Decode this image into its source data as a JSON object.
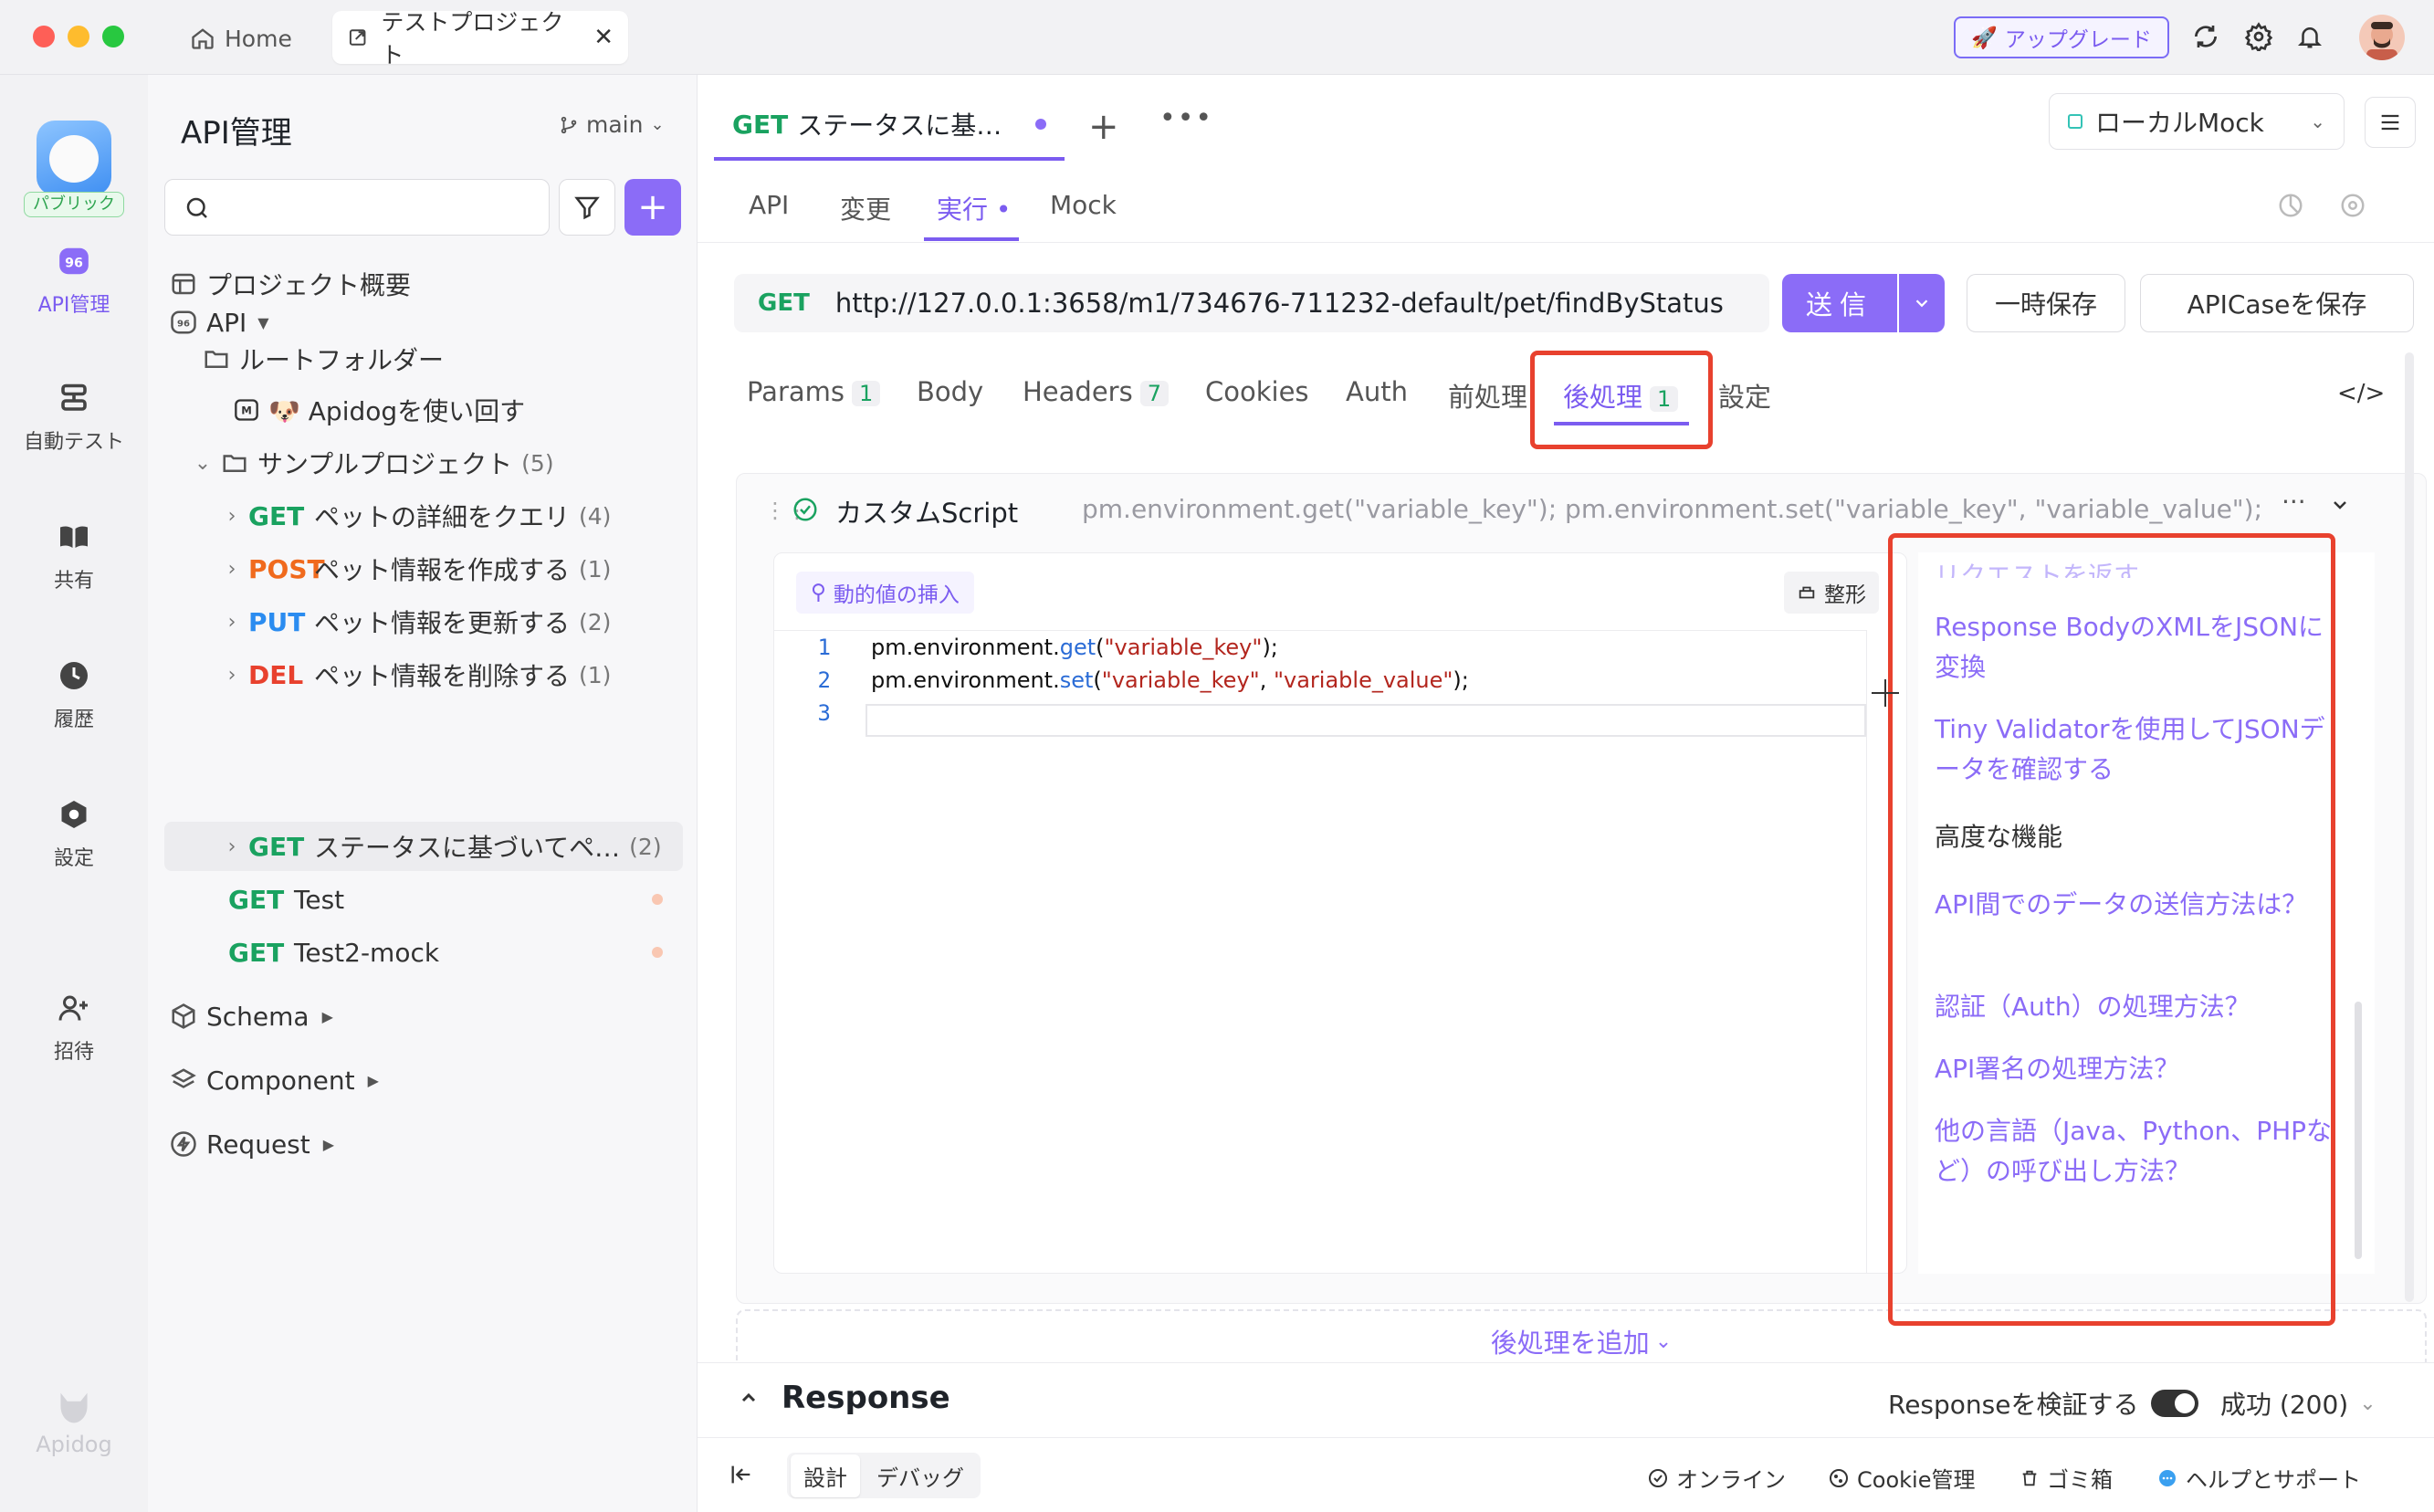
{
  "titlebar": {
    "home_label": "Home",
    "project_tab": "テストプロジェクト",
    "upgrade_label": "アップグレード"
  },
  "rail": {
    "public_badge": "パブリック",
    "items": [
      {
        "label": "API管理",
        "icon": "api-icon",
        "active": true
      },
      {
        "label": "自動テスト",
        "icon": "autotest-icon"
      },
      {
        "label": "共有",
        "icon": "book-icon"
      },
      {
        "label": "履歴",
        "icon": "clock-icon"
      },
      {
        "label": "設定",
        "icon": "hexagon-settings-icon"
      },
      {
        "label": "招待",
        "icon": "invite-icon"
      }
    ],
    "brand": "Apidog"
  },
  "sidebar": {
    "title": "API管理",
    "branch": "main",
    "search_placeholder": "",
    "overview": "プロジェクト概要",
    "api_root": "API",
    "root_folder": "ルートフォルダー",
    "apidog_doc": "🐶 Apidogを使い回す",
    "sample_project": "サンプルプロジェクト",
    "sample_count": "(5)",
    "endpoints": [
      {
        "method": "GET",
        "name": "ペットの詳細をクエリ",
        "count": "(4)"
      },
      {
        "method": "POST",
        "name": "ペット情報を作成する",
        "count": "(1)"
      },
      {
        "method": "PUT",
        "name": "ペット情報を更新する",
        "count": "(2)"
      },
      {
        "method": "DEL",
        "name": "ペット情報を削除する",
        "count": "(1)"
      },
      {
        "method": "GET",
        "name": "ステータスに基づいてペ…",
        "count": "(2)"
      }
    ],
    "extra": [
      {
        "method": "GET",
        "name": "Test"
      },
      {
        "method": "GET",
        "name": "Test2-mock"
      }
    ],
    "schema": "Schema",
    "component": "Component",
    "request": "Request"
  },
  "main": {
    "req_tab_method": "GET",
    "req_tab_name": "ステータスに基…",
    "env": "ローカルMock",
    "subtabs": [
      "API",
      "変更",
      "実行",
      "Mock"
    ],
    "url_method": "GET",
    "url": "http://127.0.0.1:3658/m1/734676-711232-default/pet/findByStatus",
    "send": "送信",
    "save_tmp": "一時保存",
    "save_case": "APICaseを保存",
    "ptabs": [
      {
        "label": "Params",
        "badge": "1"
      },
      {
        "label": "Body",
        "badge": ""
      },
      {
        "label": "Headers",
        "badge": "7"
      },
      {
        "label": "Cookies",
        "badge": ""
      },
      {
        "label": "Auth",
        "badge": ""
      },
      {
        "label": "前処理",
        "badge": ""
      },
      {
        "label": "後処理",
        "badge": "1"
      },
      {
        "label": "設定",
        "badge": ""
      }
    ],
    "script": {
      "name": "カスタムScript",
      "preview": "pm.environment.get(\"variable_key\"); pm.environment.set(\"variable_key\", \"variable_value\");",
      "dynamic_btn": "動的値の挿入",
      "format_btn": "整形",
      "lines": [
        "1",
        "2",
        "3"
      ]
    },
    "snippets": {
      "partial_top": "リクエストを返す",
      "items": [
        "Response BodyのXMLをJSONに変換",
        "Tiny Validatorを使用してJSONデータを確認する"
      ],
      "advanced_head": "高度な機能",
      "advanced": [
        "API間でのデータの送信方法は？",
        "認証（Auth）の処理方法？",
        "API署名の処理方法？",
        "他の言語（Java、Python、PHPなど）の呼び出し方法？"
      ]
    },
    "add_post": "後処理を追加",
    "response": {
      "title": "Response",
      "verify": "Responseを検証する",
      "status": "成功 (200)"
    },
    "statusbar": {
      "design": "設計",
      "debug": "デバッグ",
      "online": "オンライン",
      "cookie": "Cookie管理",
      "trash": "ゴミ箱",
      "help": "ヘルプとサポート"
    }
  },
  "colors": {
    "accent": "#8b6cf7",
    "get": "#1aa260",
    "post": "#f06a1d",
    "put": "#2b8cf0",
    "del": "#e8412e",
    "highlight": "#e8412e"
  }
}
